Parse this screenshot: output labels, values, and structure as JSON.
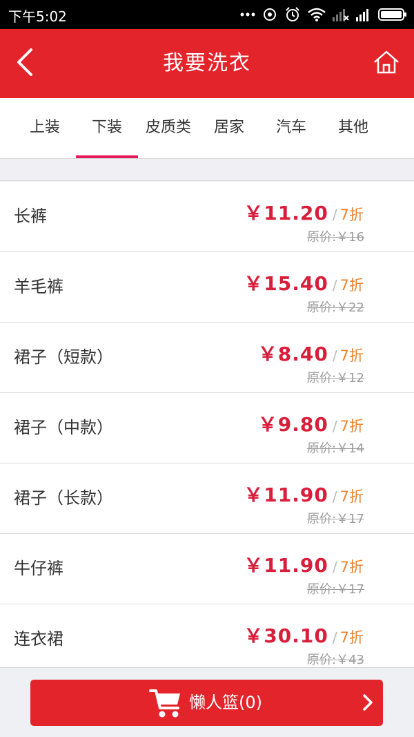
{
  "status_bar": {
    "time": "下午5:02",
    "icons": [
      "more-dots-icon",
      "sync-icon",
      "alarm-icon",
      "wifi-icon",
      "signal-no-sim-icon",
      "signal-icon",
      "battery-icon"
    ]
  },
  "nav": {
    "title": "我要洗衣",
    "back_icon": "chevron-left-icon",
    "home_icon": "home-icon"
  },
  "tabs": [
    {
      "label": "上装",
      "active": false
    },
    {
      "label": "下装",
      "active": true
    },
    {
      "label": "皮质类",
      "active": false
    },
    {
      "label": "居家",
      "active": false
    },
    {
      "label": "汽车",
      "active": false
    },
    {
      "label": "其他",
      "active": false
    }
  ],
  "items": [
    {
      "name": "长裤",
      "price": "￥11.20",
      "separator": "/",
      "discount": "7折",
      "original": "原价:￥16"
    },
    {
      "name": "羊毛裤",
      "price": "￥15.40",
      "separator": "/",
      "discount": "7折",
      "original": "原价:￥22"
    },
    {
      "name": "裙子（短款）",
      "price": "￥8.40",
      "separator": "/",
      "discount": "7折",
      "original": "原价:￥12"
    },
    {
      "name": "裙子（中款）",
      "price": "￥9.80",
      "separator": "/",
      "discount": "7折",
      "original": "原价:￥14"
    },
    {
      "name": "裙子（长款）",
      "price": "￥11.90",
      "separator": "/",
      "discount": "7折",
      "original": "原价:￥17"
    },
    {
      "name": "牛仔裤",
      "price": "￥11.90",
      "separator": "/",
      "discount": "7折",
      "original": "原价:￥17"
    },
    {
      "name": "连衣裙",
      "price": "￥30.10",
      "separator": "/",
      "discount": "7折",
      "original": "原价:￥43"
    }
  ],
  "basket": {
    "label": "懒人篮(0)",
    "icon": "shopping-cart-icon",
    "arrow_icon": "chevron-right-icon"
  },
  "colors": {
    "brand_red": "#e3242b",
    "price_red": "#d81e3b",
    "discount_orange": "#e8822f",
    "tab_indicator": "#e4185b"
  }
}
